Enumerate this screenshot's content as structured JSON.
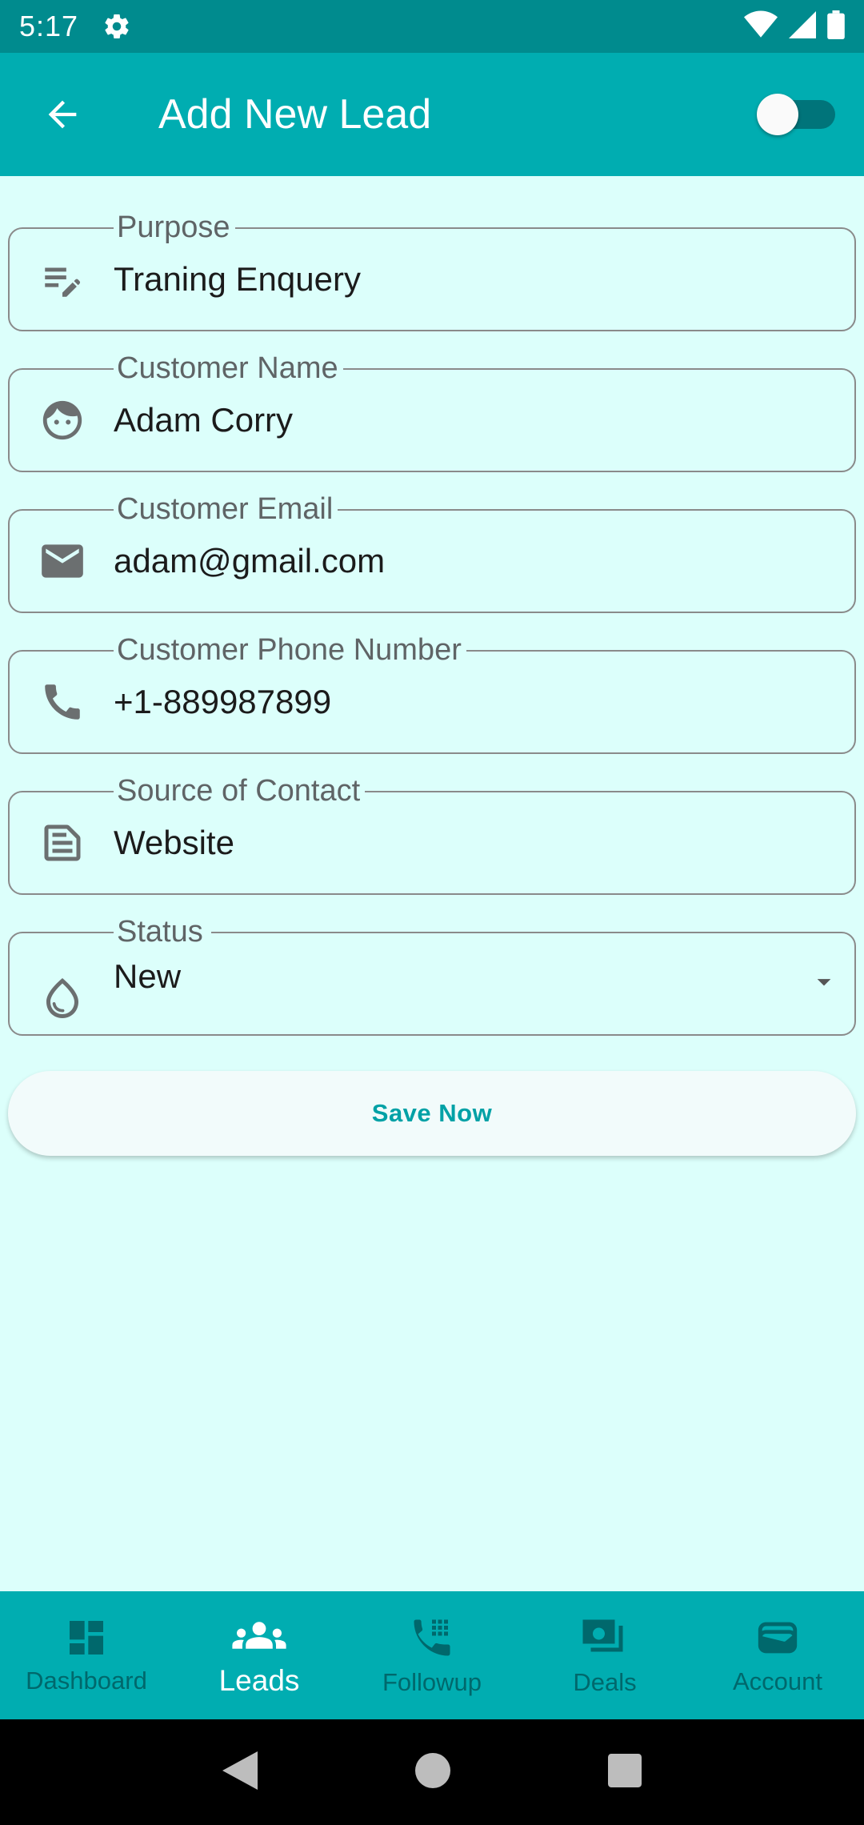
{
  "status_bar": {
    "time": "5:17",
    "icons": [
      "gear-icon",
      "wifi-icon",
      "signal-icon",
      "battery-icon"
    ]
  },
  "app_bar": {
    "title": "Add New Lead",
    "back_icon": "arrow-back-icon",
    "toggle_on": false
  },
  "form": {
    "fields": [
      {
        "label": "Purpose",
        "value": "Traning Enquery",
        "icon": "edit-note-icon"
      },
      {
        "label": "Customer Name",
        "value": "Adam Corry",
        "icon": "face-icon"
      },
      {
        "label": "Customer Email",
        "value": "adam@gmail.com",
        "icon": "email-icon"
      },
      {
        "label": "Customer Phone Number",
        "value": "+1-889987899",
        "icon": "phone-icon"
      },
      {
        "label": "Source of Contact",
        "value": "Website",
        "icon": "folder-icon"
      },
      {
        "label": "Status",
        "value": "New",
        "icon": "drop-icon"
      }
    ],
    "save_label": "Save Now"
  },
  "bottom_nav": {
    "items": [
      {
        "label": "Dashboard",
        "icon": "dashboard-icon",
        "active": false
      },
      {
        "label": "Leads",
        "icon": "people-icon",
        "active": true
      },
      {
        "label": "Followup",
        "icon": "dialpad-phone-icon",
        "active": false
      },
      {
        "label": "Deals",
        "icon": "deals-icon",
        "active": false
      },
      {
        "label": "Account",
        "icon": "wallet-icon",
        "active": false
      }
    ]
  },
  "colors": {
    "background": "#dcfffb",
    "app_bar": "#00adb1",
    "status_bar": "#008b8e",
    "accent": "#00a1a6"
  }
}
